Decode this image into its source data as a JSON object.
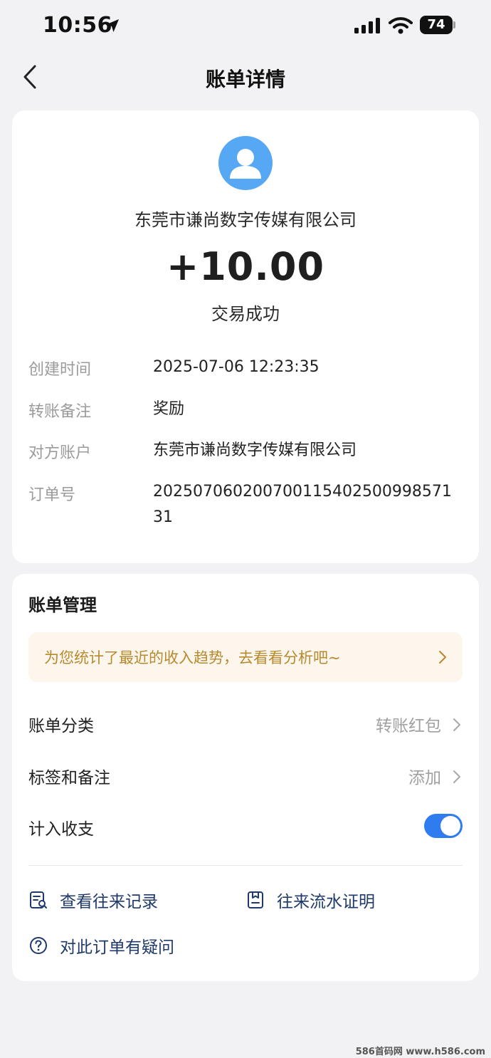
{
  "status_bar": {
    "time": "10:56",
    "battery": "74",
    "icons": [
      "location-arrow-icon",
      "cellular-signal-icon",
      "wifi-icon",
      "battery-icon"
    ]
  },
  "nav": {
    "title": "账单详情",
    "back_icon": "chevron-left-icon"
  },
  "transaction": {
    "payee": "东莞市谦尚数字传媒有限公司",
    "amount": "+10.00",
    "status": "交易成功",
    "avatar_icon": "user-avatar-icon"
  },
  "details": [
    {
      "label": "创建时间",
      "value": "2025-07-06 12:23:35"
    },
    {
      "label": "转账备注",
      "value": "奖励"
    },
    {
      "label": "对方账户",
      "value": "东莞市谦尚数字传媒有限公司"
    },
    {
      "label": "订单号",
      "value": "20250706020070011540250099857131"
    }
  ],
  "management": {
    "title": "账单管理",
    "promo": "为您统计了最近的收入趋势，去看看分析吧~",
    "rows": [
      {
        "label": "账单分类",
        "value": "转账红包"
      },
      {
        "label": "标签和备注",
        "value": "添加"
      },
      {
        "label": "计入收支",
        "toggle_on": true
      }
    ],
    "actions": [
      {
        "label": "查看往来记录",
        "icon": "record-search-icon"
      },
      {
        "label": "往来流水证明",
        "icon": "statement-icon"
      },
      {
        "label": "对此订单有疑问",
        "icon": "question-circle-icon"
      }
    ]
  },
  "watermark": "586首码网 www.h586.com",
  "colors": {
    "background": "#f2f2f4",
    "accent_blue": "#2f7bf0",
    "avatar_blue": "#56a8f5",
    "promo_bg": "#fcf6ec",
    "promo_text": "#b8892e",
    "link_text": "#1f3a6a"
  }
}
